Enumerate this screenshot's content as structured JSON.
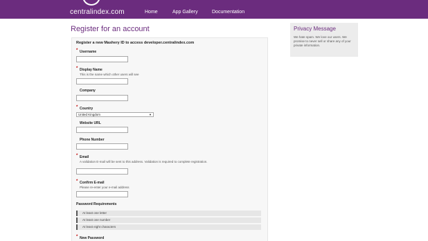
{
  "header": {
    "logo_text": "centralindex.com",
    "nav": [
      "Home",
      "App Gallery",
      "Documentation"
    ]
  },
  "page_title": "Register for an account",
  "form": {
    "legend": "Register a new Mashery ID to access developer.centralindex.com",
    "required_marker": "*",
    "fields": {
      "username": {
        "label": "Username",
        "value": ""
      },
      "display_name": {
        "label": "Display Name",
        "hint": "This is the name which other users will see",
        "value": ""
      },
      "company": {
        "label": "Company",
        "value": ""
      },
      "country": {
        "label": "Country",
        "value": "United Kingdom"
      },
      "website": {
        "label": "Website URL",
        "value": ""
      },
      "phone": {
        "label": "Phone Number",
        "value": ""
      },
      "email": {
        "label": "Email",
        "hint": "A validation E-mail will be sent to this address. Validation is required to complete registration.",
        "value": ""
      },
      "confirm_email": {
        "label": "Confirm E-mail",
        "hint": "Please re-enter your e-mail address",
        "value": ""
      },
      "new_password": {
        "label": "New Password"
      }
    },
    "password_requirements": {
      "title": "Password Requirements",
      "items": [
        "At least one letter",
        "At least one number",
        "At least eight characters"
      ]
    }
  },
  "privacy": {
    "title": "Privacy Message",
    "text": "We hate spam. We love our users. We promise to never sell or share any of your private information."
  },
  "colors": {
    "brand": "#6b2c7e",
    "required": "#c00000"
  }
}
